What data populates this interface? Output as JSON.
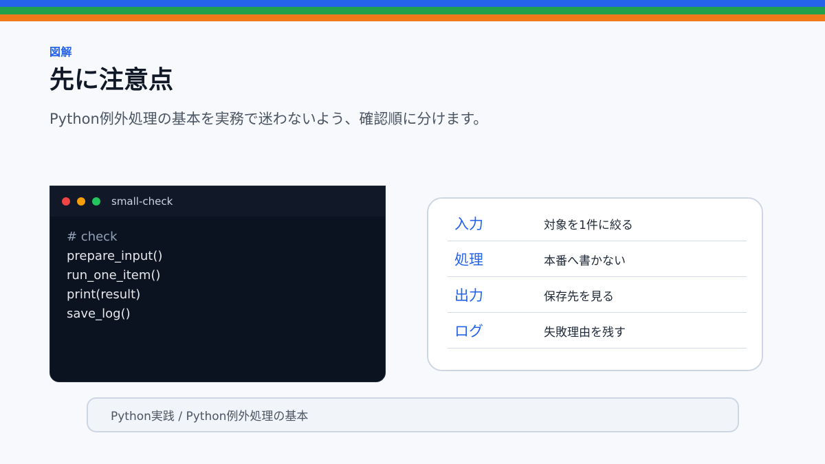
{
  "colors": {
    "stripe_top": "#2563eb",
    "stripe_middle": "#22a04b",
    "stripe_bottom": "#f07a1a",
    "accent": "#2563eb",
    "dot_red": "#ef4444",
    "dot_yellow": "#f59e0b",
    "dot_green": "#22c55e"
  },
  "header": {
    "eyebrow": "図解",
    "title": "先に注意点",
    "subtitle": "Python例外処理の基本を実務で迷わないよう、確認順に分けます。"
  },
  "code_window": {
    "title": "small-check",
    "lines": [
      "# check",
      "prepare_input()",
      "run_one_item()",
      "print(result)",
      "save_log()"
    ]
  },
  "table": {
    "rows": [
      {
        "key": "入力",
        "value": "対象を1件に絞る"
      },
      {
        "key": "処理",
        "value": "本番へ書かない"
      },
      {
        "key": "出力",
        "value": "保存先を見る"
      },
      {
        "key": "ログ",
        "value": "失敗理由を残す"
      }
    ]
  },
  "footer": {
    "breadcrumb": "Python実践 / Python例外処理の基本"
  }
}
